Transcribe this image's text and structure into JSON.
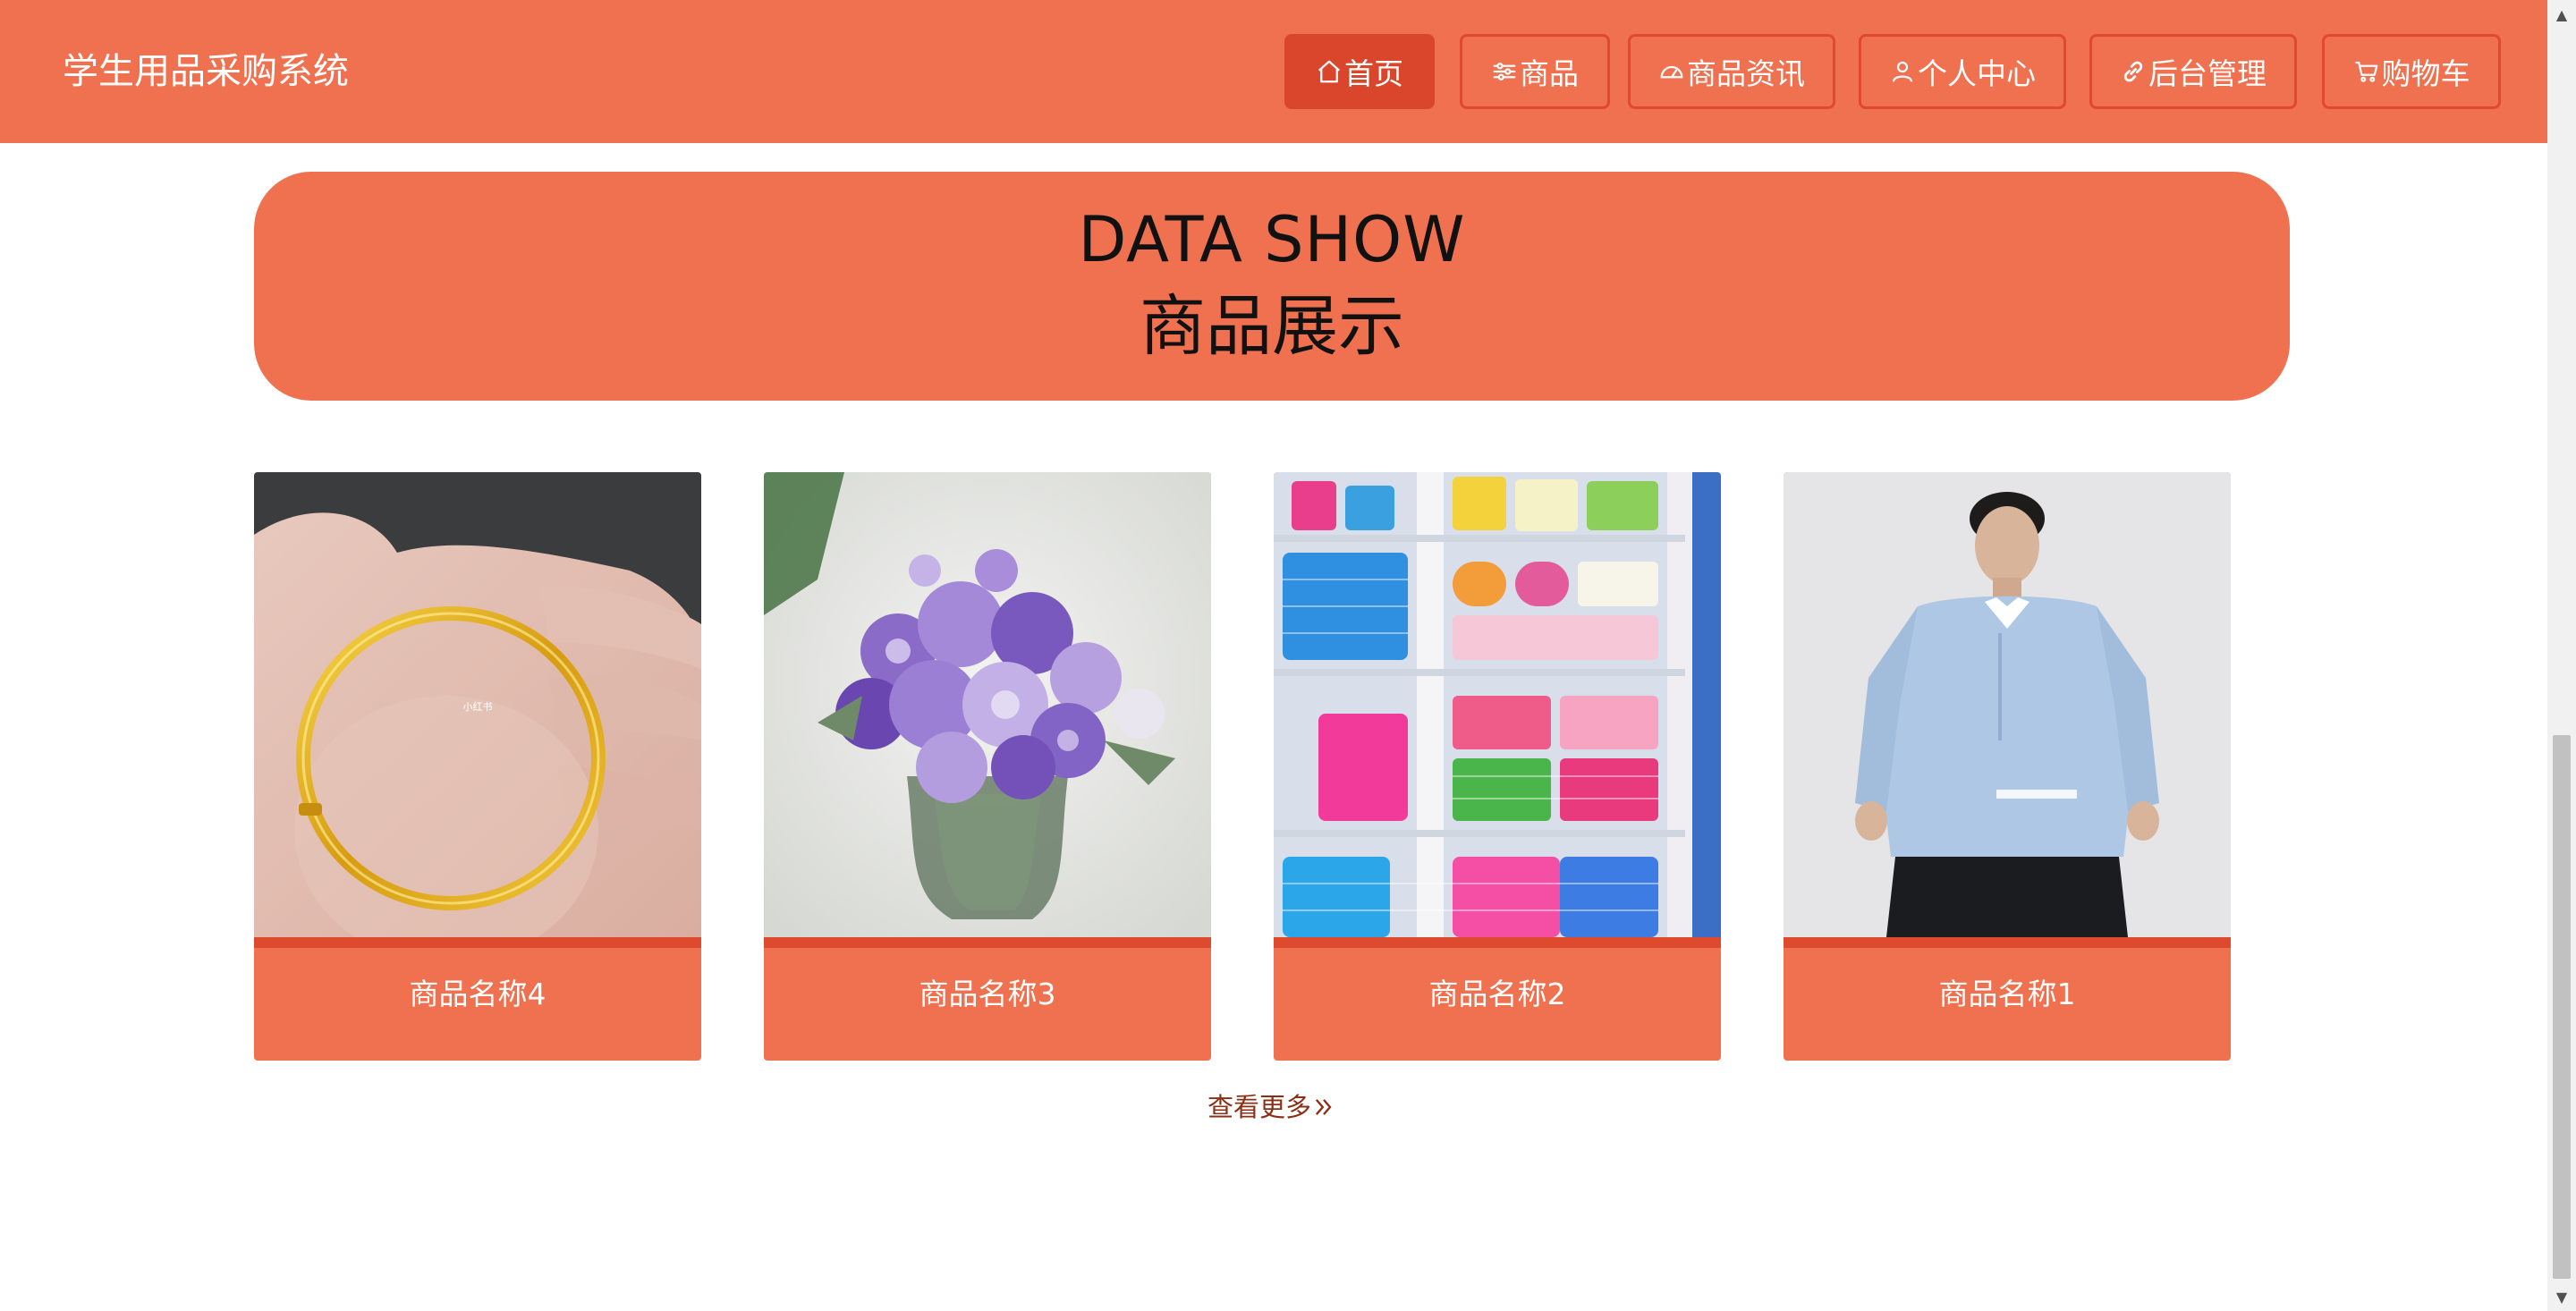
{
  "app": {
    "title": "学生用品采购系统"
  },
  "nav": {
    "items": [
      {
        "label": "首页",
        "icon": "home-icon",
        "active": true
      },
      {
        "label": "商品",
        "icon": "sliders-icon",
        "active": false
      },
      {
        "label": "商品资讯",
        "icon": "dashboard-icon",
        "active": false
      },
      {
        "label": "个人中心",
        "icon": "user-icon",
        "active": false
      },
      {
        "label": "后台管理",
        "icon": "link-icon",
        "active": false
      },
      {
        "label": "购物车",
        "icon": "cart-icon",
        "active": false
      }
    ]
  },
  "banner": {
    "title_en": "DATA SHOW",
    "title_cn": "商品展示"
  },
  "products": [
    {
      "name": "商品名称4",
      "image": "gold-bracelet-photo",
      "watermark": "小红书"
    },
    {
      "name": "商品名称3",
      "image": "flower-bouquet-photo"
    },
    {
      "name": "商品名称2",
      "image": "plastic-baskets-photo"
    },
    {
      "name": "商品名称1",
      "image": "man-in-shirt-photo"
    }
  ],
  "more": {
    "label": "查看更多",
    "icon": "double-chevron-right-icon"
  },
  "colors": {
    "primary": "#f0714f",
    "primary_dark": "#d9462b",
    "page_bg": "#ffffff",
    "more_link": "#8a2f16"
  }
}
